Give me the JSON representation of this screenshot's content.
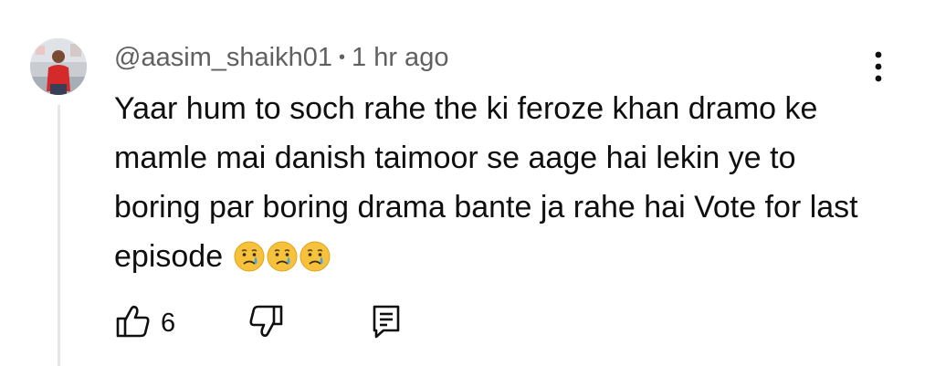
{
  "comment": {
    "author": "@aasim_shaikh01",
    "separator": "•",
    "timestamp": "1 hr ago",
    "text": "Yaar hum to soch rahe the ki feroze khan dramo ke mamle mai danish taimoor se aage hai lekin ye to boring par boring drama bante ja rahe hai Vote for last episode",
    "emojis": [
      "crying-face-emoji",
      "crying-face-emoji",
      "crying-face-emoji"
    ]
  },
  "actions": {
    "like_count": "6",
    "like_icon": "thumb-up-icon",
    "dislike_icon": "thumb-down-icon",
    "reply_icon": "comment-icon",
    "menu_icon": "kebab-menu-icon"
  },
  "colors": {
    "text": "#0f0f0f",
    "meta": "#606060",
    "thread_line": "#e6e6e6"
  }
}
